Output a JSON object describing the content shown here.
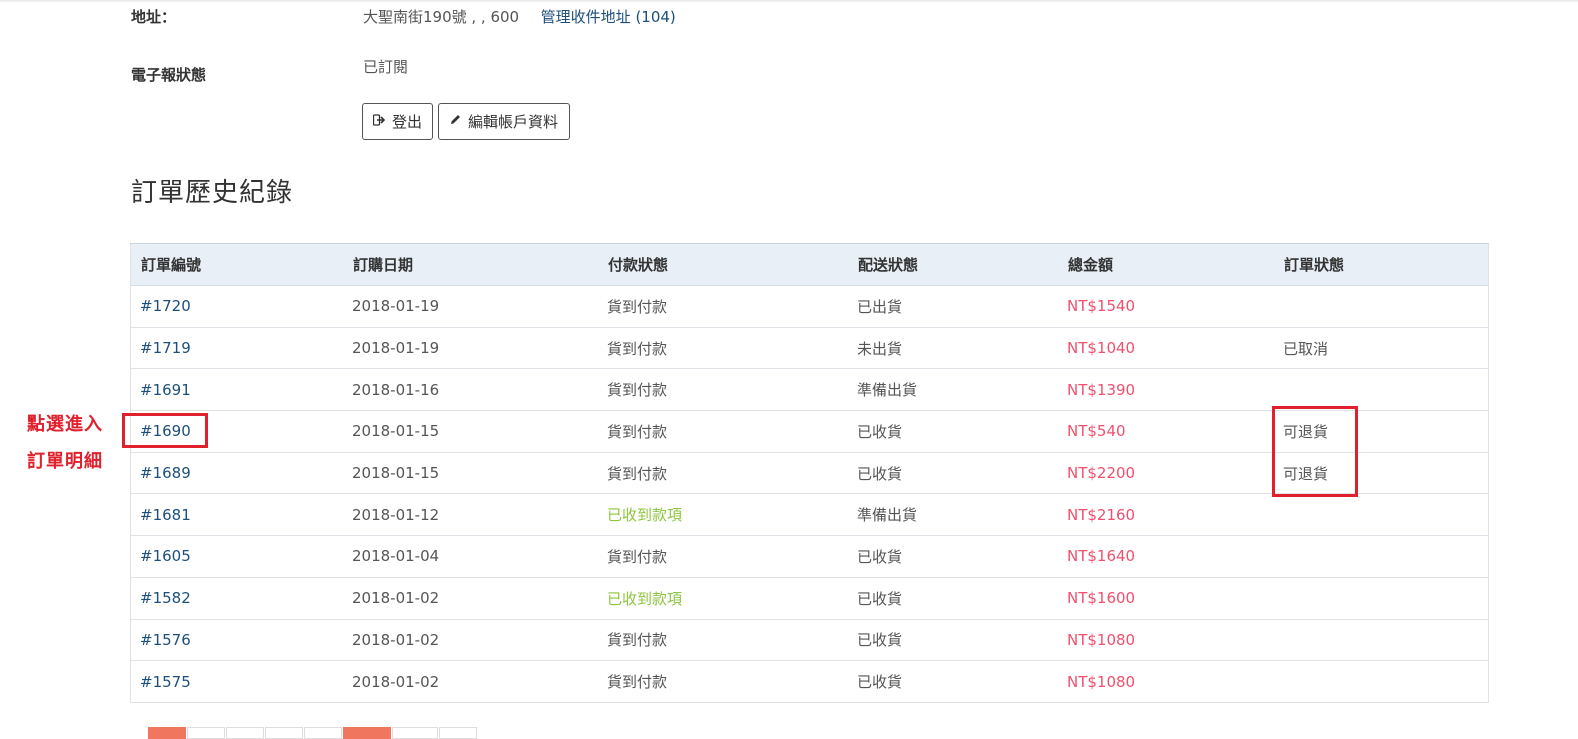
{
  "account": {
    "address_label": "地址：",
    "address_value": "大聖南街190號 , , 600",
    "manage_address_link": "管理收件地址 (104)",
    "newsletter_label": "電子報狀態",
    "newsletter_value": "已訂閱",
    "logout_label": "登出",
    "edit_account_label": "編輯帳戶資料"
  },
  "orders": {
    "title": "訂單歷史紀錄",
    "columns": [
      "訂單編號",
      "訂購日期",
      "付款狀態",
      "配送狀態",
      "總金額",
      "訂單狀態"
    ],
    "rows": [
      {
        "id": "#1720",
        "date": "2018-01-19",
        "payment": "貨到付款",
        "shipping": "已出貨",
        "total": "NT$1540",
        "status": ""
      },
      {
        "id": "#1719",
        "date": "2018-01-19",
        "payment": "貨到付款",
        "shipping": "未出貨",
        "total": "NT$1040",
        "status": "已取消"
      },
      {
        "id": "#1691",
        "date": "2018-01-16",
        "payment": "貨到付款",
        "shipping": "準備出貨",
        "total": "NT$1390",
        "status": ""
      },
      {
        "id": "#1690",
        "date": "2018-01-15",
        "payment": "貨到付款",
        "shipping": "已收貨",
        "total": "NT$540",
        "status": "可退貨"
      },
      {
        "id": "#1689",
        "date": "2018-01-15",
        "payment": "貨到付款",
        "shipping": "已收貨",
        "total": "NT$2200",
        "status": "可退貨"
      },
      {
        "id": "#1681",
        "date": "2018-01-12",
        "payment": "已收到款項",
        "shipping": "準備出貨",
        "total": "NT$2160",
        "status": ""
      },
      {
        "id": "#1605",
        "date": "2018-01-04",
        "payment": "貨到付款",
        "shipping": "已收貨",
        "total": "NT$1640",
        "status": ""
      },
      {
        "id": "#1582",
        "date": "2018-01-02",
        "payment": "已收到款項",
        "shipping": "已收貨",
        "total": "NT$1600",
        "status": ""
      },
      {
        "id": "#1576",
        "date": "2018-01-02",
        "payment": "貨到付款",
        "shipping": "已收貨",
        "total": "NT$1080",
        "status": ""
      },
      {
        "id": "#1575",
        "date": "2018-01-02",
        "payment": "貨到付款",
        "shipping": "已收貨",
        "total": "NT$1080",
        "status": ""
      }
    ]
  },
  "annotation": {
    "line1": "點選進入",
    "line2": "訂單明細"
  },
  "colors": {
    "link": "#1d4f7c",
    "price": "#f0506e",
    "paid": "#8dc63f",
    "annotation": "#e0202c",
    "header_bg": "#e9eff6"
  }
}
